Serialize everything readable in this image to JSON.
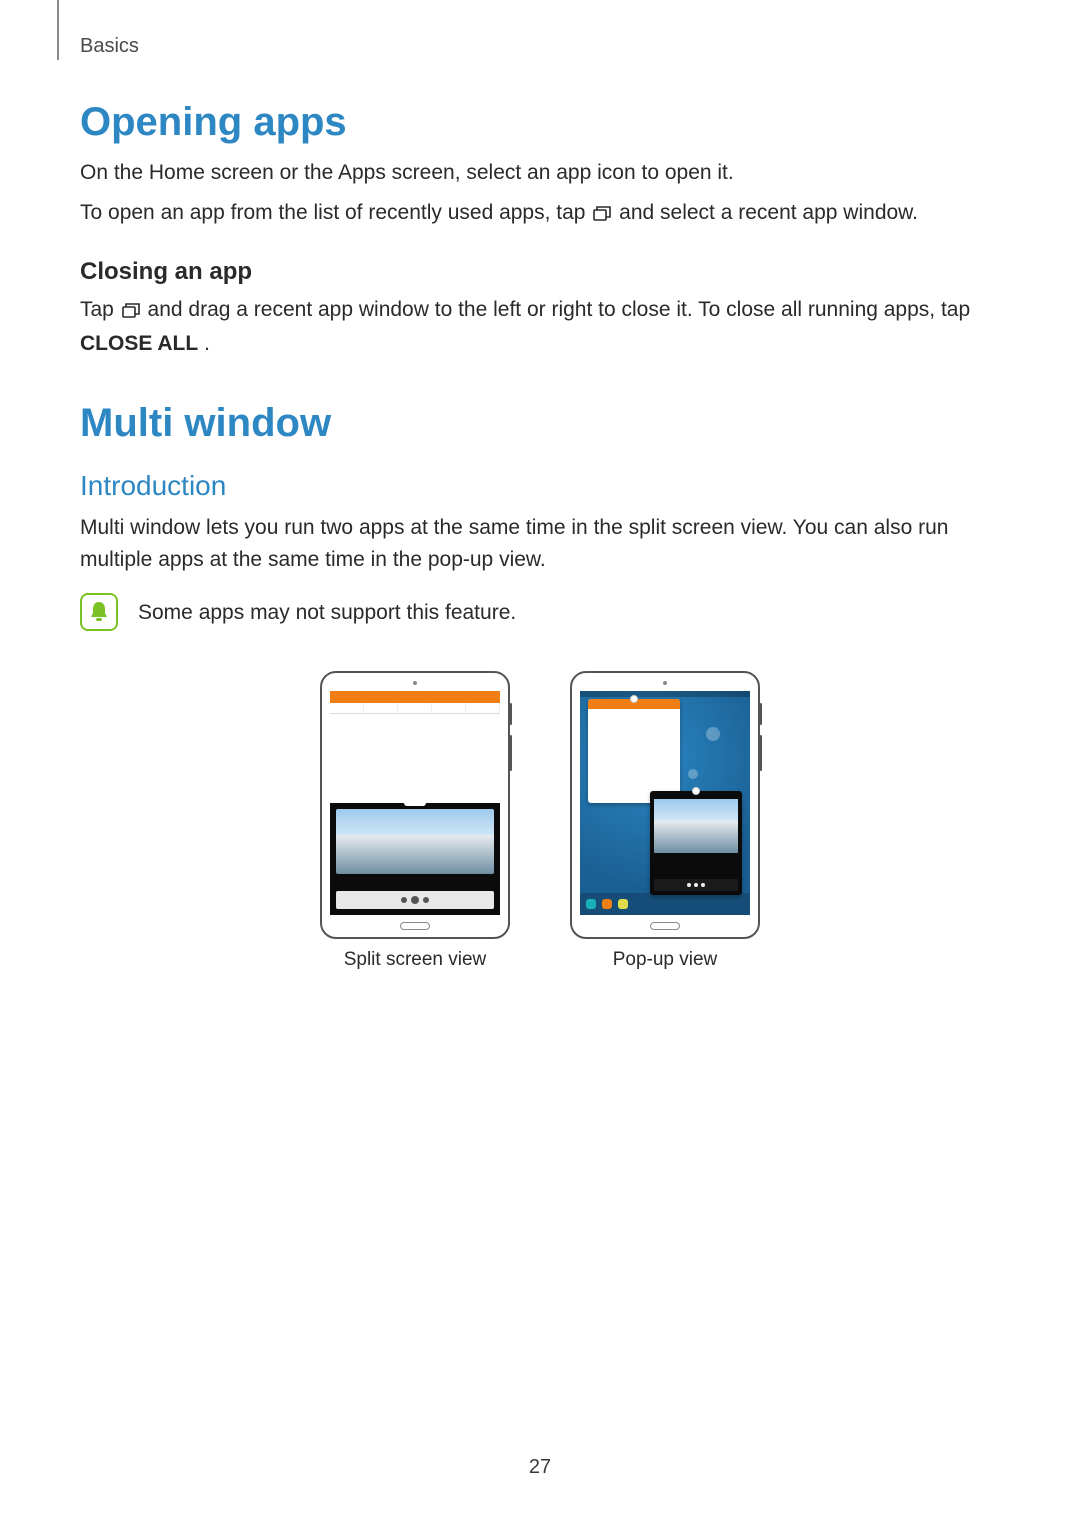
{
  "header": {
    "section": "Basics"
  },
  "opening_apps": {
    "title": "Opening apps",
    "p1a": "On the Home screen or the Apps screen, select an app icon to open it.",
    "p2a": "To open an app from the list of recently used apps, tap ",
    "p2b": " and select a recent app window.",
    "closing": {
      "title": "Closing an app",
      "p1a": "Tap ",
      "p1b": " and drag a recent app window to the left or right to close it. To close all running apps, tap ",
      "p1c": "CLOSE ALL",
      "p1d": "."
    }
  },
  "multi_window": {
    "title": "Multi window",
    "intro_title": "Introduction",
    "intro_body": "Multi window lets you run two apps at the same time in the split screen view. You can also run multiple apps at the same time in the pop-up view.",
    "note": "Some apps may not support this feature.",
    "captions": {
      "left": "Split screen view",
      "right": "Pop-up view"
    }
  },
  "page_number": "27"
}
